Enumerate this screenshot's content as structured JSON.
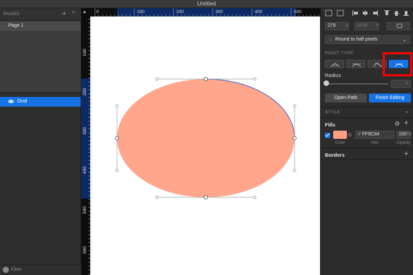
{
  "window": {
    "title": "Untitled"
  },
  "sidebar": {
    "pages_header": "PAGES",
    "pages": [
      {
        "label": "Page 1"
      }
    ],
    "layers": [
      {
        "label": "Oval",
        "icon": "eye-icon"
      }
    ],
    "filter_label": "Filter"
  },
  "rulers": {
    "top_labels": [
      "0",
      "100",
      "200",
      "300",
      "400",
      "500"
    ],
    "left_labels": [
      "100",
      "200",
      "300",
      "400",
      "500",
      "600"
    ]
  },
  "inspector": {
    "position": {
      "x_value": "279",
      "x_label": "X",
      "y_value": "Multi",
      "y_label": "Y"
    },
    "rounding": {
      "icon": "grid-icon",
      "label": "Round to half pixels"
    },
    "point_type": {
      "label": "POINT TYPE",
      "options": [
        "straight",
        "mirrored",
        "disconnected",
        "asymmetric"
      ],
      "active": "asymmetric"
    },
    "radius": {
      "label": "Radius",
      "value": "0"
    },
    "buttons": {
      "open_path": "Open Path",
      "finish_editing": "Finish Editing"
    },
    "style_label": "STYLE",
    "fills": {
      "label": "Fills",
      "enabled": true,
      "color": "#FF9C84",
      "hex": "FF9C84",
      "hash": "#",
      "opacity": "100",
      "opacity_unit": "%",
      "labels": {
        "color": "Color",
        "hex": "Hex",
        "opacity": "Opacity"
      }
    },
    "borders_label": "Borders"
  },
  "canvas": {
    "shape": {
      "name": "Oval",
      "fill": "#ffa68c",
      "edge_highlight": "#4a5cc8"
    }
  },
  "colors": {
    "accent": "#1673e6",
    "highlight": "#ff0000"
  }
}
